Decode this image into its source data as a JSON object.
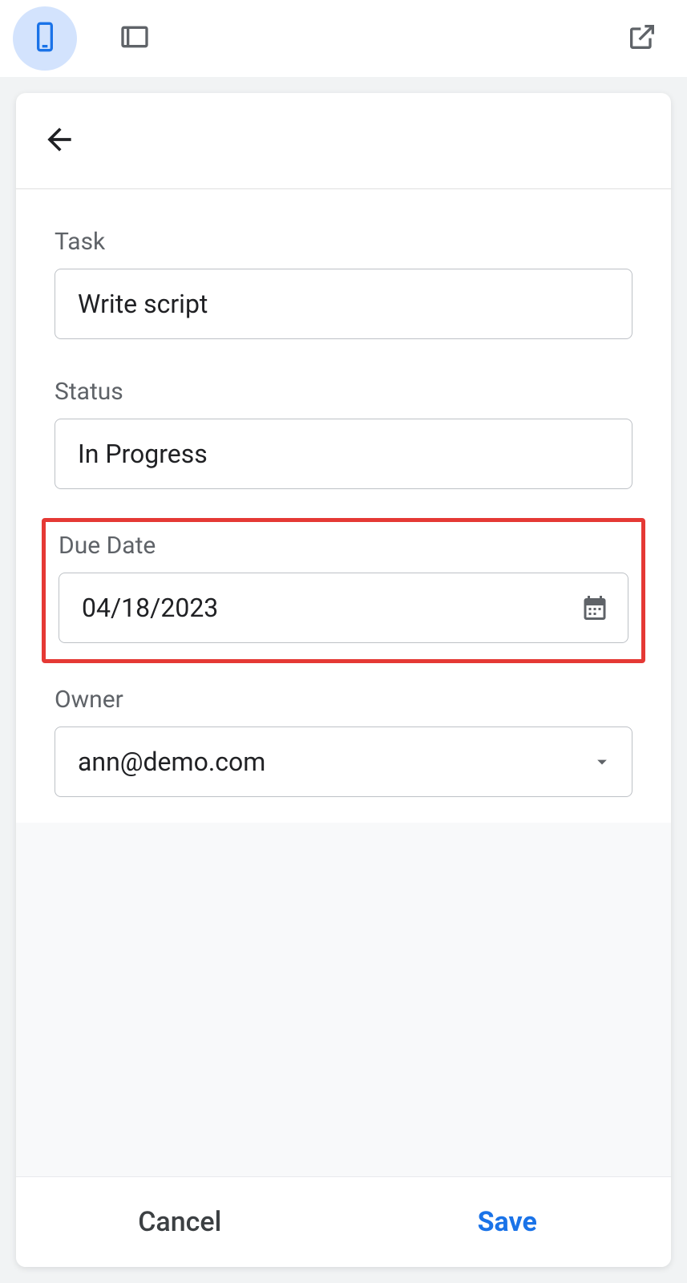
{
  "toolbar": {
    "mobile_icon": "mobile-icon",
    "tablet_icon": "tablet-icon",
    "external_icon": "external-link-icon"
  },
  "form": {
    "task": {
      "label": "Task",
      "value": "Write script"
    },
    "status": {
      "label": "Status",
      "value": "In Progress"
    },
    "due_date": {
      "label": "Due Date",
      "value": "04/18/2023"
    },
    "owner": {
      "label": "Owner",
      "value": "ann@demo.com"
    }
  },
  "footer": {
    "cancel_label": "Cancel",
    "save_label": "Save"
  }
}
